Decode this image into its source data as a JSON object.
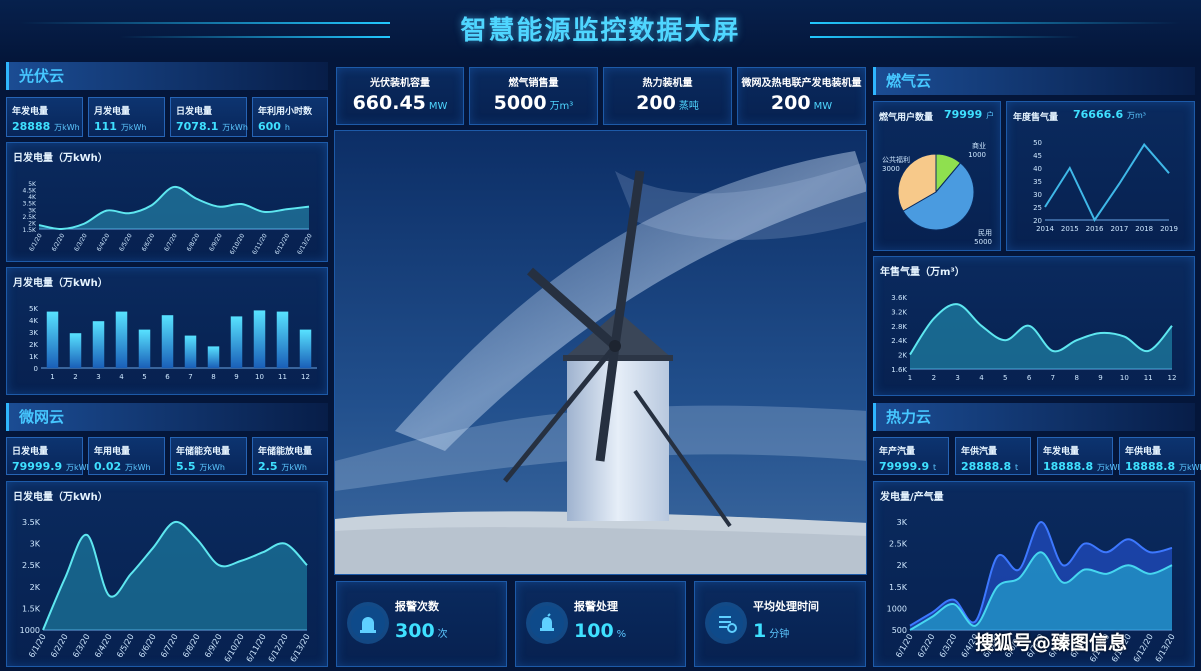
{
  "header": {
    "title": "智慧能源监控数据大屏"
  },
  "pv": {
    "section_title": "光伏云",
    "stats": [
      {
        "label": "年发电量",
        "value": "28888",
        "unit": "万kWh"
      },
      {
        "label": "月发电量",
        "value": "111",
        "unit": "万kWh"
      },
      {
        "label": "日发电量",
        "value": "7078.1",
        "unit": "万kWh"
      },
      {
        "label": "年利用小时数",
        "value": "600",
        "unit": "h"
      }
    ]
  },
  "micro": {
    "section_title": "微网云",
    "stats": [
      {
        "label": "日发电量",
        "value": "79999.9",
        "unit": "万kWh"
      },
      {
        "label": "年用电量",
        "value": "0.02",
        "unit": "万kWh"
      },
      {
        "label": "年储能充电量",
        "value": "5.5",
        "unit": "万kWh"
      },
      {
        "label": "年储能放电量",
        "value": "2.5",
        "unit": "万kWh"
      }
    ]
  },
  "kpis": [
    {
      "label": "光伏装机容量",
      "value": "660.45",
      "unit": "MW"
    },
    {
      "label": "燃气销售量",
      "value": "5000",
      "unit": "万m³"
    },
    {
      "label": "热力装机量",
      "value": "200",
      "unit": "蒸吨"
    },
    {
      "label": "微网及热电联产发电装机量",
      "value": "200",
      "unit": "MW"
    }
  ],
  "gas": {
    "section_title": "燃气云",
    "users_label": "燃气用户数量",
    "users_value": "79999",
    "users_unit": "户",
    "annual_label": "年度售气量",
    "annual_value": "76666.6",
    "annual_unit": "万m³"
  },
  "heat": {
    "section_title": "热力云",
    "stats": [
      {
        "label": "年产汽量",
        "value": "79999.9",
        "unit": "t"
      },
      {
        "label": "年供汽量",
        "value": "28888.8",
        "unit": "t"
      },
      {
        "label": "年发电量",
        "value": "18888.8",
        "unit": "万kWh"
      },
      {
        "label": "年供电量",
        "value": "18888.8",
        "unit": "万kWh"
      }
    ]
  },
  "bottom": [
    {
      "label": "报警次数",
      "value": "300",
      "unit": "次"
    },
    {
      "label": "报警处理",
      "value": "100",
      "unit": "%"
    },
    {
      "label": "平均处理时间",
      "value": "1",
      "unit": "分钟"
    }
  ],
  "watermark": "搜狐号@臻图信息",
  "colors": {
    "accent": "#3fe0ff",
    "background": "#04163a",
    "panel": "#0a2a5e",
    "border": "#1d5aa8"
  },
  "chart_data": [
    {
      "id": "pv-daily",
      "type": "area",
      "title": "日发电量（万kWh）",
      "categories": [
        "6/1/20",
        "6/2/20",
        "6/3/20",
        "6/4/20",
        "6/5/20",
        "6/6/20",
        "6/7/20",
        "6/8/20",
        "6/9/20",
        "6/10/20",
        "6/11/20",
        "6/12/20",
        "6/13/20"
      ],
      "y_ticks": [
        "1.5K",
        "2K",
        "2.5K",
        "3K",
        "3.5K",
        "4K",
        "4.5K",
        "5K"
      ],
      "ylim": [
        1500,
        5000
      ],
      "values": [
        1800,
        1500,
        1900,
        2900,
        2700,
        3300,
        4700,
        3800,
        3200,
        3400,
        2800,
        3000,
        3200
      ]
    },
    {
      "id": "pv-monthly",
      "type": "bar",
      "title": "月发电量（万kWh）",
      "categories": [
        "1",
        "2",
        "3",
        "4",
        "5",
        "6",
        "7",
        "8",
        "9",
        "10",
        "11",
        "12"
      ],
      "y_ticks": [
        "0",
        "1K",
        "2K",
        "3K",
        "4K",
        "5K"
      ],
      "ylim": [
        0,
        5000
      ],
      "values": [
        4700,
        2900,
        3900,
        4700,
        3200,
        4400,
        2700,
        1800,
        4300,
        4800,
        4700,
        3200
      ]
    },
    {
      "id": "micro-daily",
      "type": "area",
      "title": "日发电量（万kWh）",
      "categories": [
        "6/1/20",
        "6/2/20",
        "6/3/20",
        "6/4/20",
        "6/5/20",
        "6/6/20",
        "6/7/20",
        "6/8/20",
        "6/9/20",
        "6/10/20",
        "6/11/20",
        "6/12/20",
        "6/13/20"
      ],
      "y_ticks": [
        "1000",
        "1.5K",
        "2K",
        "2.5K",
        "3K",
        "3.5K"
      ],
      "ylim": [
        1000,
        3500
      ],
      "values": [
        1000,
        2200,
        3200,
        1800,
        2300,
        2900,
        3500,
        3100,
        2500,
        2600,
        2800,
        3000,
        2500
      ]
    },
    {
      "id": "gas-users",
      "type": "pie",
      "labels": [
        "商业",
        "民用",
        "公共福利"
      ],
      "values": [
        1000,
        5000,
        3000
      ],
      "colors": [
        "#8fe04f",
        "#4a9be0",
        "#f7c98a"
      ]
    },
    {
      "id": "gas-annual",
      "type": "line",
      "categories": [
        "2014",
        "2015",
        "2016",
        "2017",
        "2018",
        "2019"
      ],
      "y_ticks": [
        "20",
        "25",
        "30",
        "35",
        "40",
        "45",
        "50"
      ],
      "ylim": [
        20,
        50
      ],
      "values": [
        25,
        40,
        20,
        34,
        49,
        38
      ]
    },
    {
      "id": "gas-monthly",
      "type": "area",
      "title": "年售气量（万m³）",
      "categories": [
        "1",
        "2",
        "3",
        "4",
        "5",
        "6",
        "7",
        "8",
        "9",
        "10",
        "11",
        "12"
      ],
      "y_ticks": [
        "1.6K",
        "2K",
        "2.4K",
        "2.8K",
        "3.2K",
        "3.6K"
      ],
      "ylim": [
        1600,
        3600
      ],
      "values": [
        2000,
        3000,
        3400,
        2800,
        2400,
        2800,
        2100,
        2400,
        2600,
        2500,
        2100,
        2800
      ]
    },
    {
      "id": "heat-power-steam",
      "type": "area",
      "title": "发电量/产气量",
      "categories": [
        "6/1/20",
        "6/2/20",
        "6/3/20",
        "6/4/20",
        "6/5/20",
        "6/6/20",
        "6/7/20",
        "6/8/20",
        "6/9/20",
        "6/10/20",
        "6/11/20",
        "6/12/20",
        "6/13/20"
      ],
      "y_ticks": [
        "500",
        "1000",
        "1.5K",
        "2K",
        "2.5K",
        "3K"
      ],
      "ylim": [
        500,
        3000
      ],
      "series": [
        {
          "values": [
            600,
            900,
            1200,
            700,
            2200,
            1900,
            3000,
            2000,
            2500,
            2300,
            2600,
            2300,
            2400
          ]
        },
        {
          "values": [
            500,
            800,
            1100,
            600,
            1500,
            1700,
            2300,
            1600,
            1900,
            1800,
            2000,
            1800,
            2000
          ]
        }
      ]
    }
  ]
}
